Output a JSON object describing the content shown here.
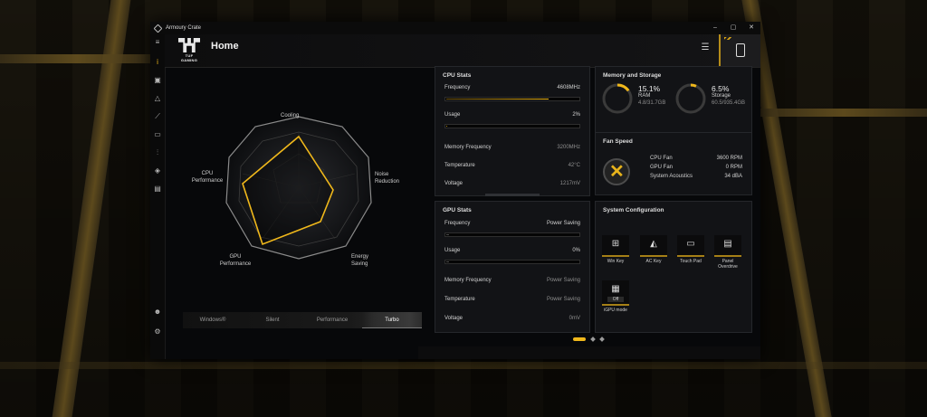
{
  "window": {
    "title": "Armoury Crate",
    "controls": [
      "–",
      "▢",
      "✕"
    ]
  },
  "header": {
    "title": "Home",
    "brand": "TUF GAMING"
  },
  "sidebar": {
    "icons": [
      "menu-icon",
      "info-icon",
      "devices-icon",
      "aura-icon",
      "scenario-icon",
      "media-icon",
      "system-icon",
      "tag-icon",
      "monitor-icon",
      "user-icon",
      "settings-icon"
    ]
  },
  "modes": {
    "axes": [
      "Cooling",
      "Noise Reduction",
      "Energy Saving",
      "GPU Performance",
      "CPU Performance"
    ],
    "tabs": [
      "Windows®",
      "Silent",
      "Performance",
      "Turbo"
    ],
    "active": "Turbo"
  },
  "cpu_stats": {
    "title": "CPU Stats",
    "frequency_label": "Frequency",
    "frequency_value": "4608MHz",
    "frequency_fill": 0.78,
    "usage_label": "Usage",
    "usage_value": "2%",
    "usage_fill": 0.02,
    "mem_freq_label": "Memory Frequency",
    "mem_freq_value": "3200MHz",
    "temp_label": "Temperature",
    "temp_value": "42°C",
    "voltage_label": "Voltage",
    "voltage_value": "1217mV"
  },
  "gpu_stats": {
    "title": "GPU Stats",
    "frequency_label": "Frequency",
    "frequency_value": "Power Saving",
    "usage_label": "Usage",
    "usage_value": "0%",
    "mem_freq_label": "Memory Frequency",
    "mem_freq_value": "Power Saving",
    "temp_label": "Temperature",
    "temp_value": "Power Saving",
    "voltage_label": "Voltage",
    "voltage_value": "0mV"
  },
  "memory_storage": {
    "title": "Memory and Storage",
    "ram_percent": "15.1%",
    "ram_label": "RAM",
    "ram_detail": "4.8/31.7GB",
    "ram_fill": 0.151,
    "storage_percent": "6.5%",
    "storage_label": "Storage",
    "storage_detail": "60.5/935.4GB",
    "storage_fill": 0.065
  },
  "fan_speed": {
    "title": "Fan Speed",
    "cpu_fan_label": "CPU Fan",
    "cpu_fan_value": "3600 RPM",
    "gpu_fan_label": "GPU Fan",
    "gpu_fan_value": "0 RPM",
    "acoustics_label": "System Acoustics",
    "acoustics_value": "34 dBA"
  },
  "system_config": {
    "title": "System Configuration",
    "win_key": "Win Key",
    "ac_key": "AC Key",
    "touch_pad": "Touch Pad",
    "panel_overdrive": "Panel Overdrive",
    "igpu_mode": "iGPU mode",
    "igpu_state": "Off"
  },
  "colors": {
    "accent": "#f0b81b",
    "panel": "#121316",
    "background": "#07080a"
  }
}
